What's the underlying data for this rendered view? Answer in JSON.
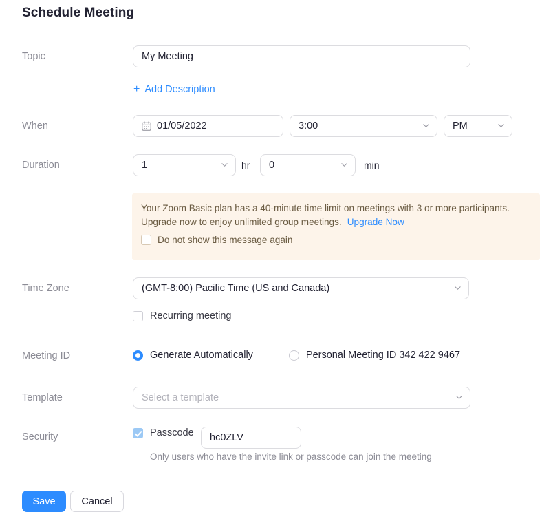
{
  "page": {
    "title": "Schedule Meeting"
  },
  "labels": {
    "topic": "Topic",
    "when": "When",
    "duration": "Duration",
    "time_zone": "Time Zone",
    "meeting_id": "Meeting ID",
    "template": "Template",
    "security": "Security"
  },
  "topic": {
    "value": "My Meeting",
    "add_description": "Add Description",
    "plus": "+"
  },
  "when": {
    "date": "01/05/2022",
    "time": "3:00",
    "meridiem": "PM"
  },
  "duration": {
    "hours": "1",
    "hr_unit": "hr",
    "minutes": "0",
    "min_unit": "min"
  },
  "banner": {
    "line1": "Your Zoom Basic plan has a 40-minute time limit on meetings with 3 or more participants.",
    "line2": "Upgrade now to enjoy unlimited group meetings.",
    "upgrade_link": "Upgrade Now",
    "dismiss_label": "Do not show this message again",
    "dismiss_checked": false,
    "bg_color": "#fdf4ea",
    "text_color": "#6b5c43"
  },
  "time_zone": {
    "value": "(GMT-8:00) Pacific Time (US and Canada)",
    "recurring_label": "Recurring meeting",
    "recurring_checked": false
  },
  "meeting_id": {
    "option_generate": "Generate Automatically",
    "option_personal": "Personal Meeting ID 342 422 9467",
    "selected": "generate"
  },
  "template": {
    "placeholder": "Select a template",
    "value": ""
  },
  "security": {
    "passcode_label": "Passcode",
    "passcode_checked": true,
    "passcode_value": "hc0ZLV",
    "hint": "Only users who have the invite link or passcode can join the meeting"
  },
  "footer": {
    "save": "Save",
    "cancel": "Cancel"
  },
  "colors": {
    "accent": "#2d8cff",
    "label_gray": "#8c8c96",
    "text": "#232333",
    "border": "#dcdce0"
  }
}
